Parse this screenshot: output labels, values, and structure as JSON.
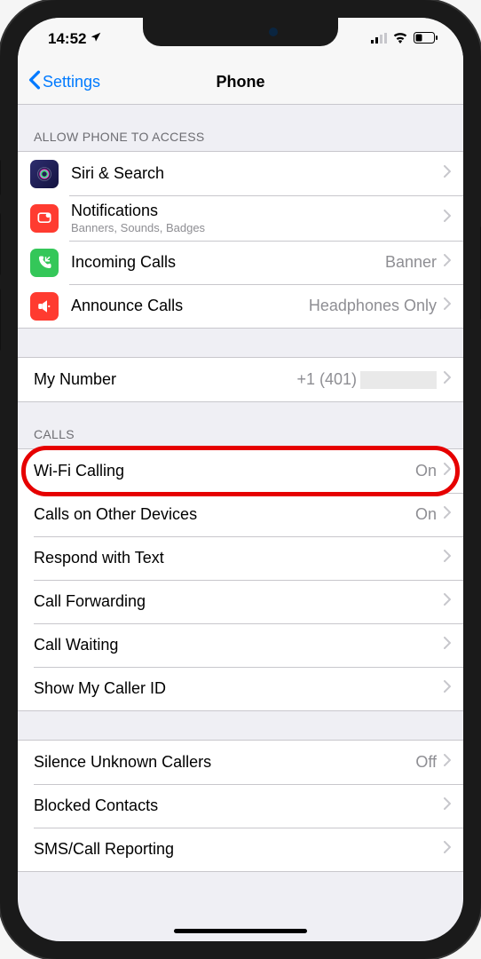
{
  "status": {
    "time": "14:52",
    "location_icon": "location-arrow"
  },
  "nav": {
    "back_label": "Settings",
    "title": "Phone"
  },
  "sections": {
    "access_header": "ALLOW PHONE TO ACCESS",
    "calls_header": "CALLS"
  },
  "rows": {
    "siri": {
      "label": "Siri & Search"
    },
    "notifications": {
      "label": "Notifications",
      "sublabel": "Banners, Sounds, Badges"
    },
    "incoming": {
      "label": "Incoming Calls",
      "value": "Banner"
    },
    "announce": {
      "label": "Announce Calls",
      "value": "Headphones Only"
    },
    "mynumber": {
      "label": "My Number",
      "value": "+1 (401)"
    },
    "wifi": {
      "label": "Wi-Fi Calling",
      "value": "On"
    },
    "otherdevices": {
      "label": "Calls on Other Devices",
      "value": "On"
    },
    "respond": {
      "label": "Respond with Text"
    },
    "forwarding": {
      "label": "Call Forwarding"
    },
    "waiting": {
      "label": "Call Waiting"
    },
    "callerid": {
      "label": "Show My Caller ID"
    },
    "silence": {
      "label": "Silence Unknown Callers",
      "value": "Off"
    },
    "blocked": {
      "label": "Blocked Contacts"
    },
    "sms": {
      "label": "SMS/Call Reporting"
    }
  }
}
